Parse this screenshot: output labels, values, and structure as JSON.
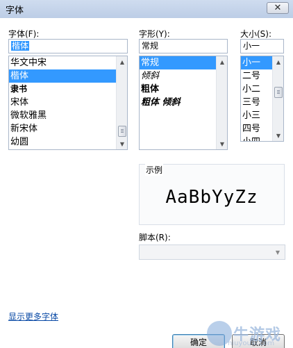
{
  "window": {
    "title": "字体",
    "close_glyph": "✕"
  },
  "font": {
    "label": "字体(F):",
    "value": "楷体",
    "items": [
      {
        "label": "华文中宋",
        "selected": false
      },
      {
        "label": "楷体",
        "selected": true
      },
      {
        "label": "隶书",
        "selected": false
      },
      {
        "label": "宋体",
        "selected": false
      },
      {
        "label": "微软雅黑",
        "selected": false
      },
      {
        "label": "新宋体",
        "selected": false
      },
      {
        "label": "幼圆",
        "selected": false
      }
    ]
  },
  "style": {
    "label": "字形(Y):",
    "value": "常规",
    "items": [
      {
        "label": "常规",
        "selected": true
      },
      {
        "label": "倾斜",
        "selected": false
      },
      {
        "label": "粗体",
        "selected": false
      },
      {
        "label": "粗体 倾斜",
        "selected": false
      }
    ]
  },
  "size": {
    "label": "大小(S):",
    "value": "小一",
    "items": [
      {
        "label": "小一",
        "selected": true
      },
      {
        "label": "二号",
        "selected": false
      },
      {
        "label": "小二",
        "selected": false
      },
      {
        "label": "三号",
        "selected": false
      },
      {
        "label": "小三",
        "selected": false
      },
      {
        "label": "四号",
        "selected": false
      },
      {
        "label": "小四",
        "selected": false
      }
    ]
  },
  "preview": {
    "label": "示例",
    "sample": "AaBbYyZz"
  },
  "script": {
    "label": "脚本(R):",
    "value": ""
  },
  "more_fonts_link": "显示更多字体",
  "buttons": {
    "ok": "确定",
    "cancel": "取消"
  },
  "watermark": {
    "text": "牛游戏",
    "url": "niuyouxi.com"
  },
  "icons": {
    "scroll_up": "▲",
    "scroll_down": "▼",
    "combo_arrow": "▼"
  },
  "colors": {
    "selection": "#3399ff",
    "link": "#0a4aa6",
    "title_bar": "#c6d5ec"
  }
}
